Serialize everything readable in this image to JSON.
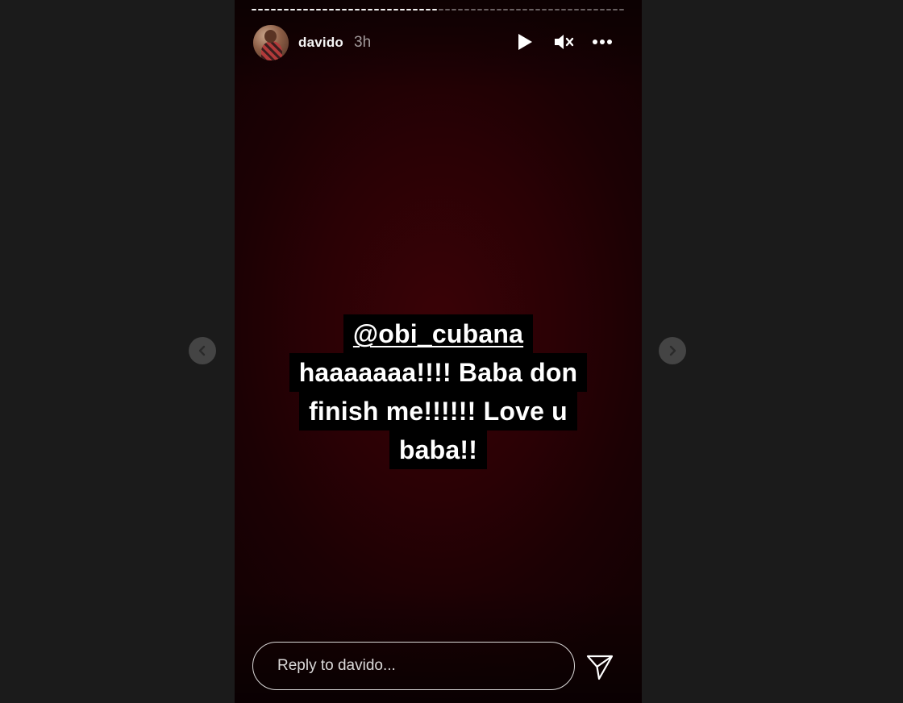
{
  "story": {
    "progress_segments_total": 58,
    "progress_segments_done": 29,
    "username": "davido",
    "posted_ago": "3h",
    "background_color": "#2a0105",
    "caption": {
      "mention": "@obi_cubana",
      "lines": [
        "haaaaaaa!!!! Baba don",
        "finish me!!!!!! Love u",
        "baba!!"
      ]
    }
  },
  "header": {
    "icons": [
      "play-icon",
      "mute-icon",
      "more-options-icon"
    ]
  },
  "navigation": {
    "prev_icon": "chevron-left-icon",
    "next_icon": "chevron-right-icon"
  },
  "reply": {
    "placeholder": "Reply to davido...",
    "send_icon": "send-icon"
  }
}
